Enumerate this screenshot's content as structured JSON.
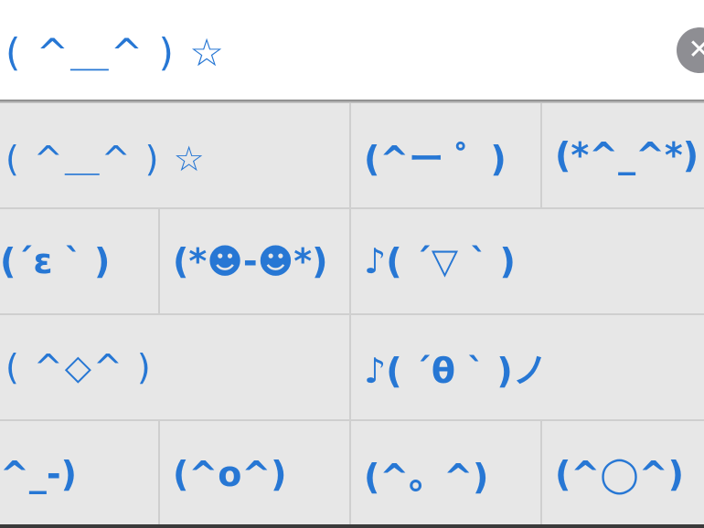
{
  "input": {
    "text": "( ^＿^ ) ☆",
    "clear_label": "✕"
  },
  "grid": {
    "rows": [
      [
        "( ^＿^ ) ☆",
        "(^ー ゜)",
        "(*^_^*)"
      ],
      [
        "(´ε ` )",
        "(*☻-☻*)",
        "♪( ´▽ ` )"
      ],
      [
        "( ^◇^ )",
        "♪( ´θ ` )ノ"
      ],
      [
        "^_-)",
        "(^o^)",
        "(^。^)",
        "(^◯^)"
      ]
    ]
  }
}
